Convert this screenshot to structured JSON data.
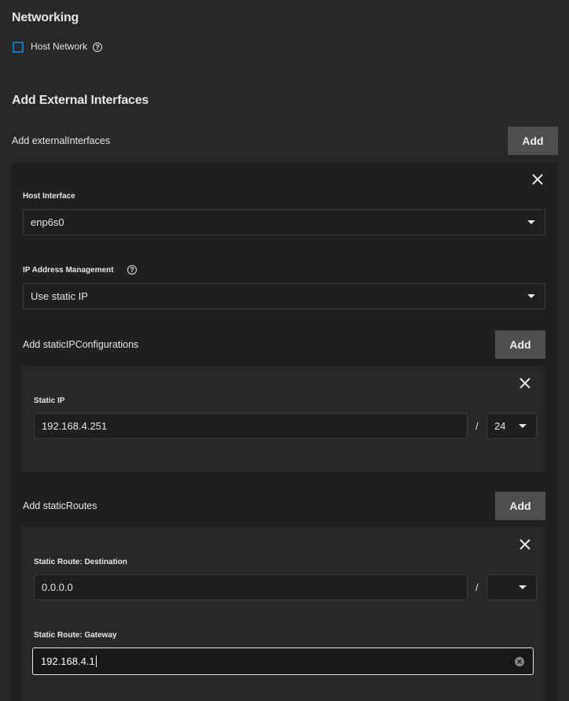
{
  "networking": {
    "title": "Networking",
    "host_network_label": "Host Network",
    "host_network_checked": false
  },
  "external": {
    "title": "Add External Interfaces",
    "add_row_label": "Add externalInterfaces",
    "add_button": "Add",
    "host_interface_label": "Host Interface",
    "host_interface_value": "enp6s0",
    "ipam_label": "IP Address Management",
    "ipam_value": "Use static IP",
    "static_ip_configs_label": "Add staticIPConfigurations",
    "static_ip_configs_add": "Add",
    "static_ip_label": "Static IP",
    "static_ip_value": "192.168.4.251",
    "static_ip_slash": "/",
    "static_ip_cidr": "24",
    "static_routes_label": "Add staticRoutes",
    "static_routes_add": "Add",
    "route_dest_label": "Static Route: Destination",
    "route_dest_value": "0.0.0.0",
    "route_dest_slash": "/",
    "route_dest_cidr": "",
    "route_gw_label": "Static Route: Gateway",
    "route_gw_value": "192.168.4.1"
  },
  "colors": {
    "background": "#282828",
    "panel": "#202020",
    "button": "#4e4e4e",
    "checkbox_accent": "#0a7ac4"
  }
}
